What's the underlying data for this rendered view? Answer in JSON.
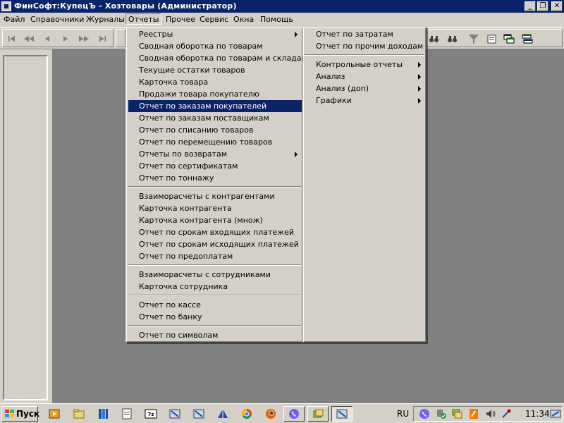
{
  "window": {
    "title": "ФинСофт:КупецЪ - Хозтовары  (Администратор)"
  },
  "menubar": {
    "items": [
      "Файл",
      "Справочники",
      "Журналы",
      "Отчеты",
      "Прочее",
      "Сервис",
      "Окна",
      "Помощь"
    ]
  },
  "reports_menu": {
    "items": [
      "Реестры",
      "Сводная оборотка по товарам",
      "Сводная оборотка по товарам и складам",
      "Текущие остатки товаров",
      "Карточка товара",
      "Продажи товара покупателю",
      "Отчет по заказам покупателей",
      "Отчет по заказам поставщикам",
      "Отчет по списанию товаров",
      "Отчет по перемещению товаров",
      "Отчеты по возвратам",
      "Отчет по сертификатам",
      "Отчет по тоннажу",
      "Взаиморасчеты с контрагентами",
      "Карточка контрагента",
      "Карточка контрагента (множ)",
      "Отчет по срокам входящих платежей",
      "Отчет по срокам исходящих платежей",
      "Отчет по предоплатам",
      "Взаиморасчеты с сотрудниками",
      "Карточка сотрудника",
      "Отчет по кассе",
      "Отчет по банку",
      "Отчет по символам"
    ],
    "highlighted": "Отчет по заказам покупателей"
  },
  "column2_menu": {
    "items": [
      "Отчет по затратам",
      "Отчет по прочим доходам",
      "Контрольные отчеты",
      "Анализ",
      "Анализ (доп)",
      "Графики"
    ]
  },
  "taskbar": {
    "start_label": "Пуск",
    "language": "RU",
    "clock": "11:34"
  },
  "colors": {
    "titlebar": "#0a246a",
    "face": "#d4d0c8",
    "desktop": "#808080",
    "highlight": "#0a246a"
  }
}
